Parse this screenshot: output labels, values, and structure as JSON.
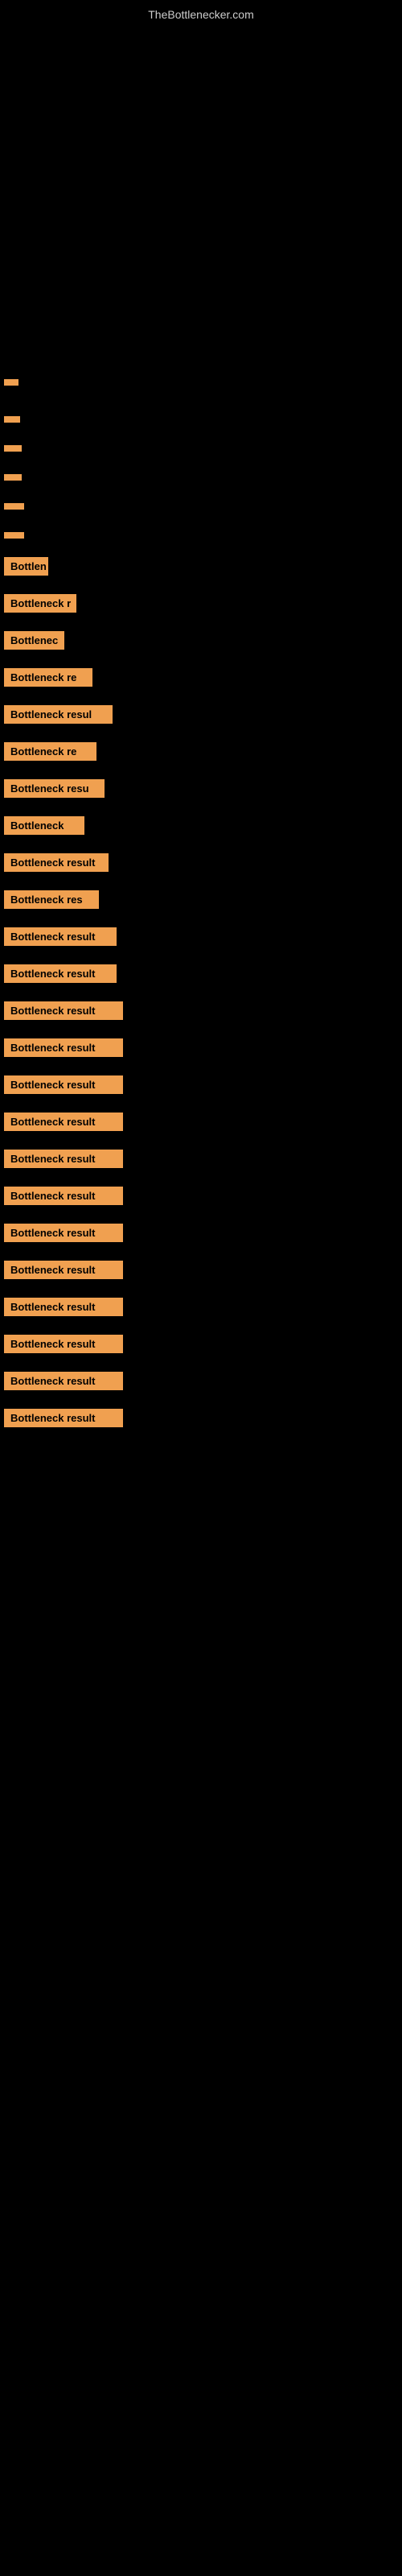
{
  "site": {
    "title": "TheBottlenecker.com"
  },
  "items": [
    {
      "id": 1,
      "label": ""
    },
    {
      "id": 2,
      "label": ""
    },
    {
      "id": 3,
      "label": ""
    },
    {
      "id": 4,
      "label": ""
    },
    {
      "id": 5,
      "label": ""
    },
    {
      "id": 6,
      "label": ""
    },
    {
      "id": 7,
      "label": "Bottlen"
    },
    {
      "id": 8,
      "label": "Bottleneck r"
    },
    {
      "id": 9,
      "label": "Bottlenec"
    },
    {
      "id": 10,
      "label": "Bottleneck re"
    },
    {
      "id": 11,
      "label": "Bottleneck resul"
    },
    {
      "id": 12,
      "label": "Bottleneck re"
    },
    {
      "id": 13,
      "label": "Bottleneck resu"
    },
    {
      "id": 14,
      "label": "Bottleneck"
    },
    {
      "id": 15,
      "label": "Bottleneck result"
    },
    {
      "id": 16,
      "label": "Bottleneck res"
    },
    {
      "id": 17,
      "label": "Bottleneck result"
    },
    {
      "id": 18,
      "label": "Bottleneck result"
    },
    {
      "id": 19,
      "label": "Bottleneck result"
    },
    {
      "id": 20,
      "label": "Bottleneck result"
    },
    {
      "id": 21,
      "label": "Bottleneck result"
    },
    {
      "id": 22,
      "label": "Bottleneck result"
    },
    {
      "id": 23,
      "label": "Bottleneck result"
    },
    {
      "id": 24,
      "label": "Bottleneck result"
    },
    {
      "id": 25,
      "label": "Bottleneck result"
    },
    {
      "id": 26,
      "label": "Bottleneck result"
    },
    {
      "id": 27,
      "label": "Bottleneck result"
    },
    {
      "id": 28,
      "label": "Bottleneck result"
    },
    {
      "id": 29,
      "label": "Bottleneck result"
    },
    {
      "id": 30,
      "label": "Bottleneck result"
    }
  ]
}
